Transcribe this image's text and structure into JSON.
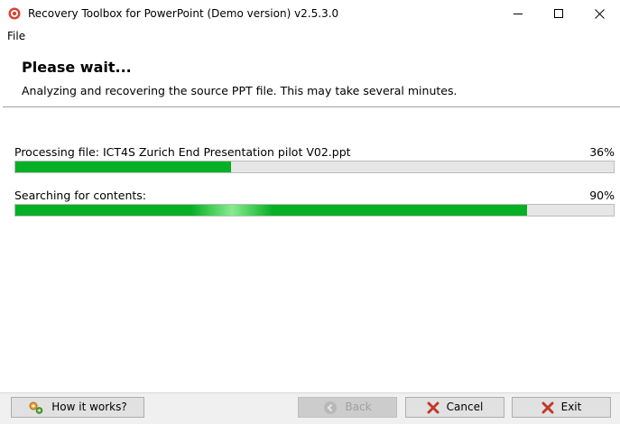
{
  "window": {
    "title": "Recovery Toolbox for PowerPoint (Demo version) v2.5.3.0",
    "icon": "app-logo-icon",
    "controls": [
      "minimize-icon",
      "maximize-icon",
      "close-icon"
    ]
  },
  "menu": {
    "items": [
      {
        "label": "File"
      }
    ]
  },
  "header": {
    "title": "Please wait...",
    "subtitle": "Analyzing and recovering the source PPT file. This may take several minutes."
  },
  "progress": [
    {
      "label": "Processing file: ICT4S Zurich End Presentation pilot V02.ppt",
      "percent_text": "36%",
      "value": 0.36
    },
    {
      "label": "Searching for contents:",
      "percent_text": "90%",
      "value": 0.855
    }
  ],
  "footer": {
    "how_label": "How it works?",
    "back_label": "Back",
    "cancel_label": "Cancel",
    "exit_label": "Exit"
  },
  "colors": {
    "progress_fill": "#06b025",
    "progress_track": "#e6e6e6",
    "cancel_icon": "#c0392b",
    "app_icon": "#d9432f"
  }
}
